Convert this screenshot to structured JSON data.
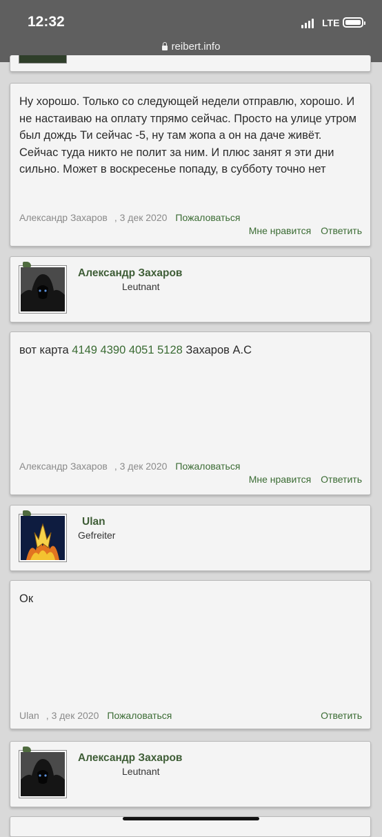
{
  "status": {
    "time": "12:32",
    "network": "LTE",
    "url": "reibert.info"
  },
  "posts": [
    {
      "id": "post-1",
      "text": "Ну хорошо. Только со следующей недели отправлю, хорошо. И не настаиваю на оплату тпрямо сейчас. Просто на улице утром был дождь Ти сейчас -5, ну там жопа а он на даче живёт. Сейчас туда никто не полит за ним. И плюс занят я эти дни сильно. Может в воскресенье попаду, в субботу точно нет",
      "author": "Александр Захаров",
      "date": ", 3 дек 2020",
      "report": "Пожаловаться",
      "like": "Мне нравится",
      "reply": "Ответить"
    },
    {
      "id": "user-1",
      "name": "Александр Захаров",
      "rank": "Leutnant",
      "avatar_icon": "hooded-figure-icon"
    },
    {
      "id": "post-2",
      "text_prefix": "вот карта",
      "card_number": "4149 4390 4051 5128",
      "text_suffix": "Захаров А.С",
      "author": "Александр Захаров",
      "date": ", 3 дек 2020",
      "report": "Пожаловаться",
      "like": "Мне нравится",
      "reply": "Ответить"
    },
    {
      "id": "user-2",
      "name": "Ulan",
      "rank": "Gefreiter",
      "avatar_icon": "trident-emblem-icon"
    },
    {
      "id": "post-3",
      "text": "Ок",
      "author": "Ulan",
      "date": ", 3 дек 2020",
      "report": "Пожаловаться",
      "reply": "Ответить"
    },
    {
      "id": "user-3",
      "name": "Александр Захаров",
      "rank": "Leutnant",
      "avatar_icon": "hooded-figure-icon"
    }
  ],
  "colors": {
    "link": "#3a6b33",
    "username": "#3e5d36",
    "meta": "#8a8a8a",
    "card_bg": "#f4f4f4",
    "page_bg": "#d9d9d9"
  }
}
